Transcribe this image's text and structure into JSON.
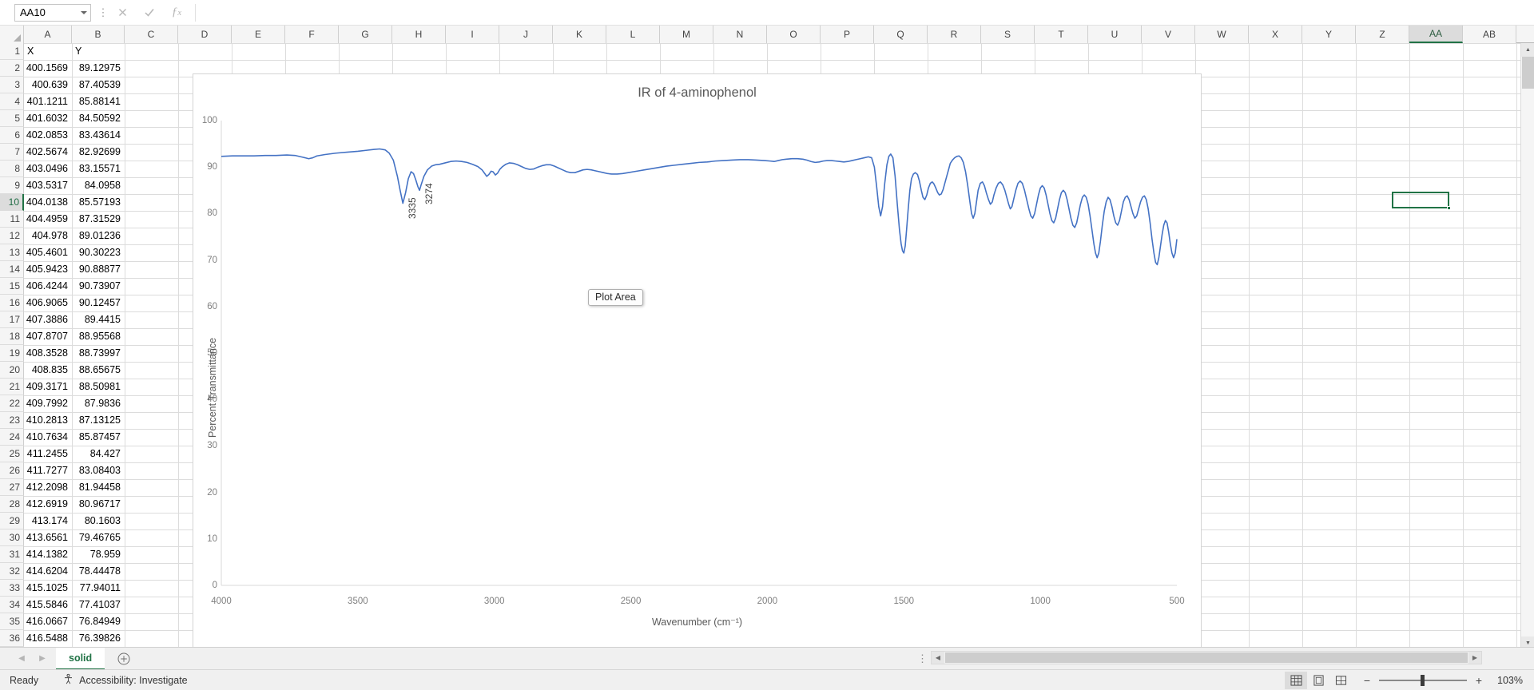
{
  "formula_bar": {
    "name_box_value": "AA10",
    "formula_value": "",
    "cancel_icon": "close-icon",
    "confirm_icon": "check-icon",
    "function_icon": "fx-icon",
    "more_icon": "ellipsis-vertical-icon",
    "dropdown_icon": "chevron-down-icon"
  },
  "grid": {
    "columns": [
      "A",
      "B",
      "C",
      "D",
      "E",
      "F",
      "G",
      "H",
      "I",
      "J",
      "K",
      "L",
      "M",
      "N",
      "O",
      "P",
      "Q",
      "R",
      "S",
      "T",
      "U",
      "V",
      "W",
      "X",
      "Y",
      "Z",
      "AA",
      "AB"
    ],
    "selected_column": "AA",
    "selected_row": 10,
    "row_numbers": [
      1,
      2,
      3,
      4,
      5,
      6,
      7,
      8,
      9,
      10,
      11,
      12,
      13,
      14,
      15,
      16,
      17,
      18,
      19,
      20,
      21,
      22,
      23,
      24,
      25,
      26,
      27,
      28,
      29,
      30,
      31,
      32,
      33,
      34,
      35,
      36
    ],
    "headers": {
      "a": "X",
      "b": "Y"
    },
    "rows": [
      {
        "r": 2,
        "x": "400.1569",
        "y": "89.12975"
      },
      {
        "r": 3,
        "x": "400.639",
        "y": "87.40539"
      },
      {
        "r": 4,
        "x": "401.1211",
        "y": "85.88141"
      },
      {
        "r": 5,
        "x": "401.6032",
        "y": "84.50592"
      },
      {
        "r": 6,
        "x": "402.0853",
        "y": "83.43614"
      },
      {
        "r": 7,
        "x": "402.5674",
        "y": "82.92699"
      },
      {
        "r": 8,
        "x": "403.0496",
        "y": "83.15571"
      },
      {
        "r": 9,
        "x": "403.5317",
        "y": "84.0958"
      },
      {
        "r": 10,
        "x": "404.0138",
        "y": "85.57193"
      },
      {
        "r": 11,
        "x": "404.4959",
        "y": "87.31529"
      },
      {
        "r": 12,
        "x": "404.978",
        "y": "89.01236"
      },
      {
        "r": 13,
        "x": "405.4601",
        "y": "90.30223"
      },
      {
        "r": 14,
        "x": "405.9423",
        "y": "90.88877"
      },
      {
        "r": 15,
        "x": "406.4244",
        "y": "90.73907"
      },
      {
        "r": 16,
        "x": "406.9065",
        "y": "90.12457"
      },
      {
        "r": 17,
        "x": "407.3886",
        "y": "89.4415"
      },
      {
        "r": 18,
        "x": "407.8707",
        "y": "88.95568"
      },
      {
        "r": 19,
        "x": "408.3528",
        "y": "88.73997"
      },
      {
        "r": 20,
        "x": "408.835",
        "y": "88.65675"
      },
      {
        "r": 21,
        "x": "409.3171",
        "y": "88.50981"
      },
      {
        "r": 22,
        "x": "409.7992",
        "y": "87.9836"
      },
      {
        "r": 23,
        "x": "410.2813",
        "y": "87.13125"
      },
      {
        "r": 24,
        "x": "410.7634",
        "y": "85.87457"
      },
      {
        "r": 25,
        "x": "411.2455",
        "y": "84.427"
      },
      {
        "r": 26,
        "x": "411.7277",
        "y": "83.08403"
      },
      {
        "r": 27,
        "x": "412.2098",
        "y": "81.94458"
      },
      {
        "r": 28,
        "x": "412.6919",
        "y": "80.96717"
      },
      {
        "r": 29,
        "x": "413.174",
        "y": "80.1603"
      },
      {
        "r": 30,
        "x": "413.6561",
        "y": "79.46765"
      },
      {
        "r": 31,
        "x": "414.1382",
        "y": "78.959"
      },
      {
        "r": 32,
        "x": "414.6204",
        "y": "78.44478"
      },
      {
        "r": 33,
        "x": "415.1025",
        "y": "77.94011"
      },
      {
        "r": 34,
        "x": "415.5846",
        "y": "77.41037"
      },
      {
        "r": 35,
        "x": "416.0667",
        "y": "76.84949"
      },
      {
        "r": 36,
        "x": "416.5488",
        "y": "76.39826"
      }
    ]
  },
  "chart_data": {
    "type": "line",
    "title": "IR of 4-aminophenol",
    "xlabel": "Wavenumber (cm⁻¹)",
    "ylabel": "Percent Transmittance",
    "series_color": "#4472C4",
    "xticks": [
      "4000",
      "3500",
      "3000",
      "2500",
      "2000",
      "1500",
      "1000",
      "500"
    ],
    "xtick_values": [
      4000,
      3500,
      3000,
      2500,
      2000,
      1500,
      1000,
      500
    ],
    "yticks": [
      "0",
      "10",
      "20",
      "30",
      "40",
      "50",
      "60",
      "70",
      "80",
      "90",
      "100"
    ],
    "ytick_values": [
      0,
      10,
      20,
      30,
      40,
      50,
      60,
      70,
      80,
      90,
      100
    ],
    "xlim": [
      4000,
      500
    ],
    "ylim": [
      0,
      100
    ],
    "x_reversed": true,
    "grid": false,
    "legend": "none",
    "annotations": [
      {
        "label": "3335",
        "wavenumber": 3335,
        "transmittance": 82
      },
      {
        "label": "3274",
        "wavenumber": 3274,
        "transmittance": 85
      }
    ],
    "points": [
      [
        4000,
        92.3
      ],
      [
        3960,
        92.4
      ],
      [
        3920,
        92.4
      ],
      [
        3880,
        92.4
      ],
      [
        3840,
        92.5
      ],
      [
        3800,
        92.5
      ],
      [
        3760,
        92.6
      ],
      [
        3730,
        92.5
      ],
      [
        3700,
        92.1
      ],
      [
        3680,
        91.8
      ],
      [
        3665,
        92.0
      ],
      [
        3650,
        92.4
      ],
      [
        3620,
        92.7
      ],
      [
        3580,
        93.0
      ],
      [
        3540,
        93.2
      ],
      [
        3500,
        93.4
      ],
      [
        3470,
        93.6
      ],
      [
        3440,
        93.8
      ],
      [
        3420,
        93.9
      ],
      [
        3400,
        93.7
      ],
      [
        3385,
        93.0
      ],
      [
        3370,
        91.5
      ],
      [
        3355,
        88.0
      ],
      [
        3345,
        85.0
      ],
      [
        3335,
        82.2
      ],
      [
        3325,
        84.5
      ],
      [
        3315,
        87.5
      ],
      [
        3305,
        89.0
      ],
      [
        3296,
        88.6
      ],
      [
        3288,
        87.3
      ],
      [
        3280,
        85.8
      ],
      [
        3274,
        85.0
      ],
      [
        3268,
        86.2
      ],
      [
        3258,
        88.0
      ],
      [
        3245,
        89.4
      ],
      [
        3230,
        90.2
      ],
      [
        3215,
        90.5
      ],
      [
        3200,
        90.6
      ],
      [
        3180,
        90.9
      ],
      [
        3160,
        91.2
      ],
      [
        3140,
        91.3
      ],
      [
        3120,
        91.2
      ],
      [
        3100,
        91.0
      ],
      [
        3080,
        90.6
      ],
      [
        3060,
        90.1
      ],
      [
        3045,
        89.4
      ],
      [
        3035,
        88.6
      ],
      [
        3028,
        88.0
      ],
      [
        3020,
        88.4
      ],
      [
        3012,
        89.1
      ],
      [
        3005,
        89.0
      ],
      [
        2996,
        88.3
      ],
      [
        2988,
        88.7
      ],
      [
        2980,
        89.5
      ],
      [
        2970,
        90.1
      ],
      [
        2958,
        90.6
      ],
      [
        2945,
        90.9
      ],
      [
        2930,
        90.8
      ],
      [
        2915,
        90.5
      ],
      [
        2900,
        90.1
      ],
      [
        2885,
        89.7
      ],
      [
        2870,
        89.5
      ],
      [
        2855,
        89.6
      ],
      [
        2840,
        90.0
      ],
      [
        2825,
        90.3
      ],
      [
        2810,
        90.5
      ],
      [
        2795,
        90.5
      ],
      [
        2780,
        90.2
      ],
      [
        2765,
        89.8
      ],
      [
        2750,
        89.4
      ],
      [
        2735,
        89.0
      ],
      [
        2720,
        88.8
      ],
      [
        2705,
        88.8
      ],
      [
        2690,
        89.1
      ],
      [
        2675,
        89.4
      ],
      [
        2660,
        89.5
      ],
      [
        2645,
        89.4
      ],
      [
        2630,
        89.2
      ],
      [
        2615,
        89.0
      ],
      [
        2600,
        88.8
      ],
      [
        2585,
        88.6
      ],
      [
        2570,
        88.5
      ],
      [
        2550,
        88.5
      ],
      [
        2530,
        88.6
      ],
      [
        2510,
        88.8
      ],
      [
        2490,
        89.0
      ],
      [
        2470,
        89.2
      ],
      [
        2450,
        89.4
      ],
      [
        2430,
        89.6
      ],
      [
        2400,
        89.9
      ],
      [
        2370,
        90.2
      ],
      [
        2340,
        90.4
      ],
      [
        2310,
        90.6
      ],
      [
        2280,
        90.8
      ],
      [
        2250,
        91.0
      ],
      [
        2220,
        91.1
      ],
      [
        2190,
        91.3
      ],
      [
        2160,
        91.4
      ],
      [
        2130,
        91.5
      ],
      [
        2100,
        91.6
      ],
      [
        2070,
        91.6
      ],
      [
        2040,
        91.5
      ],
      [
        2010,
        91.4
      ],
      [
        1990,
        91.3
      ],
      [
        1975,
        91.2
      ],
      [
        1960,
        91.4
      ],
      [
        1945,
        91.6
      ],
      [
        1930,
        91.7
      ],
      [
        1910,
        91.8
      ],
      [
        1890,
        91.8
      ],
      [
        1870,
        91.7
      ],
      [
        1855,
        91.5
      ],
      [
        1840,
        91.2
      ],
      [
        1825,
        91.0
      ],
      [
        1810,
        91.1
      ],
      [
        1795,
        91.3
      ],
      [
        1780,
        91.4
      ],
      [
        1765,
        91.4
      ],
      [
        1750,
        91.3
      ],
      [
        1735,
        91.2
      ],
      [
        1720,
        91.1
      ],
      [
        1705,
        91.2
      ],
      [
        1690,
        91.4
      ],
      [
        1675,
        91.6
      ],
      [
        1660,
        91.8
      ],
      [
        1645,
        92.0
      ],
      [
        1630,
        92.2
      ],
      [
        1618,
        92.0
      ],
      [
        1608,
        90.0
      ],
      [
        1600,
        86.0
      ],
      [
        1592,
        81.5
      ],
      [
        1585,
        79.5
      ],
      [
        1578,
        81.5
      ],
      [
        1570,
        86.5
      ],
      [
        1562,
        90.5
      ],
      [
        1555,
        92.3
      ],
      [
        1548,
        92.8
      ],
      [
        1540,
        92.0
      ],
      [
        1532,
        88.0
      ],
      [
        1524,
        82.0
      ],
      [
        1516,
        76.5
      ],
      [
        1510,
        73.5
      ],
      [
        1505,
        72.0
      ],
      [
        1500,
        71.5
      ],
      [
        1495,
        73.0
      ],
      [
        1490,
        76.5
      ],
      [
        1484,
        81.0
      ],
      [
        1478,
        85.0
      ],
      [
        1472,
        87.5
      ],
      [
        1465,
        88.5
      ],
      [
        1458,
        88.8
      ],
      [
        1450,
        88.4
      ],
      [
        1443,
        87.0
      ],
      [
        1436,
        85.0
      ],
      [
        1430,
        83.5
      ],
      [
        1423,
        83.0
      ],
      [
        1416,
        84.0
      ],
      [
        1410,
        85.5
      ],
      [
        1403,
        86.5
      ],
      [
        1396,
        86.8
      ],
      [
        1390,
        86.4
      ],
      [
        1383,
        85.5
      ],
      [
        1376,
        84.5
      ],
      [
        1370,
        84.0
      ],
      [
        1363,
        84.2
      ],
      [
        1356,
        85.2
      ],
      [
        1350,
        86.5
      ],
      [
        1343,
        88.0
      ],
      [
        1336,
        89.5
      ],
      [
        1330,
        90.8
      ],
      [
        1322,
        91.5
      ],
      [
        1314,
        92.0
      ],
      [
        1306,
        92.3
      ],
      [
        1298,
        92.4
      ],
      [
        1290,
        92.0
      ],
      [
        1282,
        91.0
      ],
      [
        1274,
        89.0
      ],
      [
        1266,
        86.0
      ],
      [
        1258,
        82.5
      ],
      [
        1252,
        80.0
      ],
      [
        1246,
        79.0
      ],
      [
        1240,
        80.0
      ],
      [
        1234,
        82.5
      ],
      [
        1228,
        85.0
      ],
      [
        1220,
        86.5
      ],
      [
        1212,
        86.8
      ],
      [
        1205,
        86.0
      ],
      [
        1198,
        84.5
      ],
      [
        1190,
        83.0
      ],
      [
        1183,
        82.0
      ],
      [
        1176,
        82.5
      ],
      [
        1170,
        84.0
      ],
      [
        1162,
        85.5
      ],
      [
        1154,
        86.5
      ],
      [
        1146,
        86.8
      ],
      [
        1138,
        86.2
      ],
      [
        1130,
        85.0
      ],
      [
        1123,
        83.5
      ],
      [
        1116,
        82.0
      ],
      [
        1110,
        81.0
      ],
      [
        1104,
        81.5
      ],
      [
        1098,
        83.0
      ],
      [
        1090,
        85.0
      ],
      [
        1082,
        86.5
      ],
      [
        1074,
        87.0
      ],
      [
        1066,
        86.5
      ],
      [
        1058,
        85.0
      ],
      [
        1050,
        83.0
      ],
      [
        1042,
        81.0
      ],
      [
        1035,
        79.5
      ],
      [
        1028,
        79.0
      ],
      [
        1021,
        80.0
      ],
      [
        1014,
        82.0
      ],
      [
        1007,
        84.0
      ],
      [
        1000,
        85.5
      ],
      [
        993,
        86.0
      ],
      [
        986,
        85.5
      ],
      [
        979,
        84.0
      ],
      [
        972,
        82.0
      ],
      [
        965,
        80.0
      ],
      [
        958,
        78.5
      ],
      [
        951,
        78.0
      ],
      [
        944,
        79.0
      ],
      [
        937,
        81.0
      ],
      [
        930,
        83.0
      ],
      [
        923,
        84.5
      ],
      [
        916,
        85.0
      ],
      [
        909,
        84.5
      ],
      [
        902,
        83.0
      ],
      [
        895,
        81.0
      ],
      [
        888,
        79.0
      ],
      [
        881,
        77.5
      ],
      [
        874,
        77.0
      ],
      [
        867,
        78.0
      ],
      [
        860,
        80.0
      ],
      [
        853,
        82.0
      ],
      [
        846,
        83.5
      ],
      [
        839,
        84.0
      ],
      [
        832,
        83.5
      ],
      [
        825,
        82.0
      ],
      [
        818,
        79.5
      ],
      [
        811,
        76.5
      ],
      [
        804,
        73.5
      ],
      [
        798,
        71.5
      ],
      [
        792,
        70.5
      ],
      [
        786,
        71.5
      ],
      [
        780,
        74.0
      ],
      [
        773,
        77.5
      ],
      [
        766,
        80.5
      ],
      [
        759,
        82.5
      ],
      [
        752,
        83.5
      ],
      [
        745,
        83.0
      ],
      [
        738,
        81.5
      ],
      [
        731,
        79.5
      ],
      [
        724,
        78.0
      ],
      [
        717,
        77.5
      ],
      [
        710,
        78.5
      ],
      [
        703,
        80.5
      ],
      [
        696,
        82.5
      ],
      [
        689,
        83.5
      ],
      [
        682,
        83.8
      ],
      [
        675,
        83.0
      ],
      [
        668,
        81.5
      ],
      [
        661,
        80.0
      ],
      [
        654,
        79.0
      ],
      [
        647,
        79.5
      ],
      [
        640,
        81.0
      ],
      [
        633,
        82.5
      ],
      [
        626,
        83.5
      ],
      [
        619,
        83.8
      ],
      [
        612,
        83.0
      ],
      [
        605,
        81.0
      ],
      [
        598,
        78.0
      ],
      [
        591,
        74.5
      ],
      [
        584,
        71.5
      ],
      [
        578,
        69.5
      ],
      [
        572,
        69.0
      ],
      [
        566,
        70.5
      ],
      [
        560,
        73.0
      ],
      [
        554,
        75.5
      ],
      [
        548,
        77.5
      ],
      [
        542,
        78.5
      ],
      [
        536,
        78.0
      ],
      [
        530,
        76.0
      ],
      [
        524,
        73.5
      ],
      [
        518,
        71.5
      ],
      [
        512,
        70.5
      ],
      [
        506,
        71.5
      ],
      [
        500,
        74.5
      ]
    ]
  },
  "chart_overlay": {
    "plot_area_tooltip": "Plot Area"
  },
  "sheet_tabs": {
    "prev_icon": "chevron-left-icon",
    "next_icon": "chevron-right-icon",
    "tabs": [
      {
        "label": "solid",
        "active": true
      }
    ],
    "add_sheet_icon": "plus-circle-icon",
    "ellipsis": "⋮"
  },
  "status_bar": {
    "ready_text": "Ready",
    "accessibility_text": "Accessibility: Investigate",
    "accessibility_icon": "accessibility-icon",
    "view_normal_icon": "normal-view-icon",
    "view_pagelayout_icon": "page-layout-view-icon",
    "view_pagebreak_icon": "page-break-view-icon",
    "zoom_out_label": "−",
    "zoom_in_label": "+",
    "zoom_percent": "103%"
  }
}
